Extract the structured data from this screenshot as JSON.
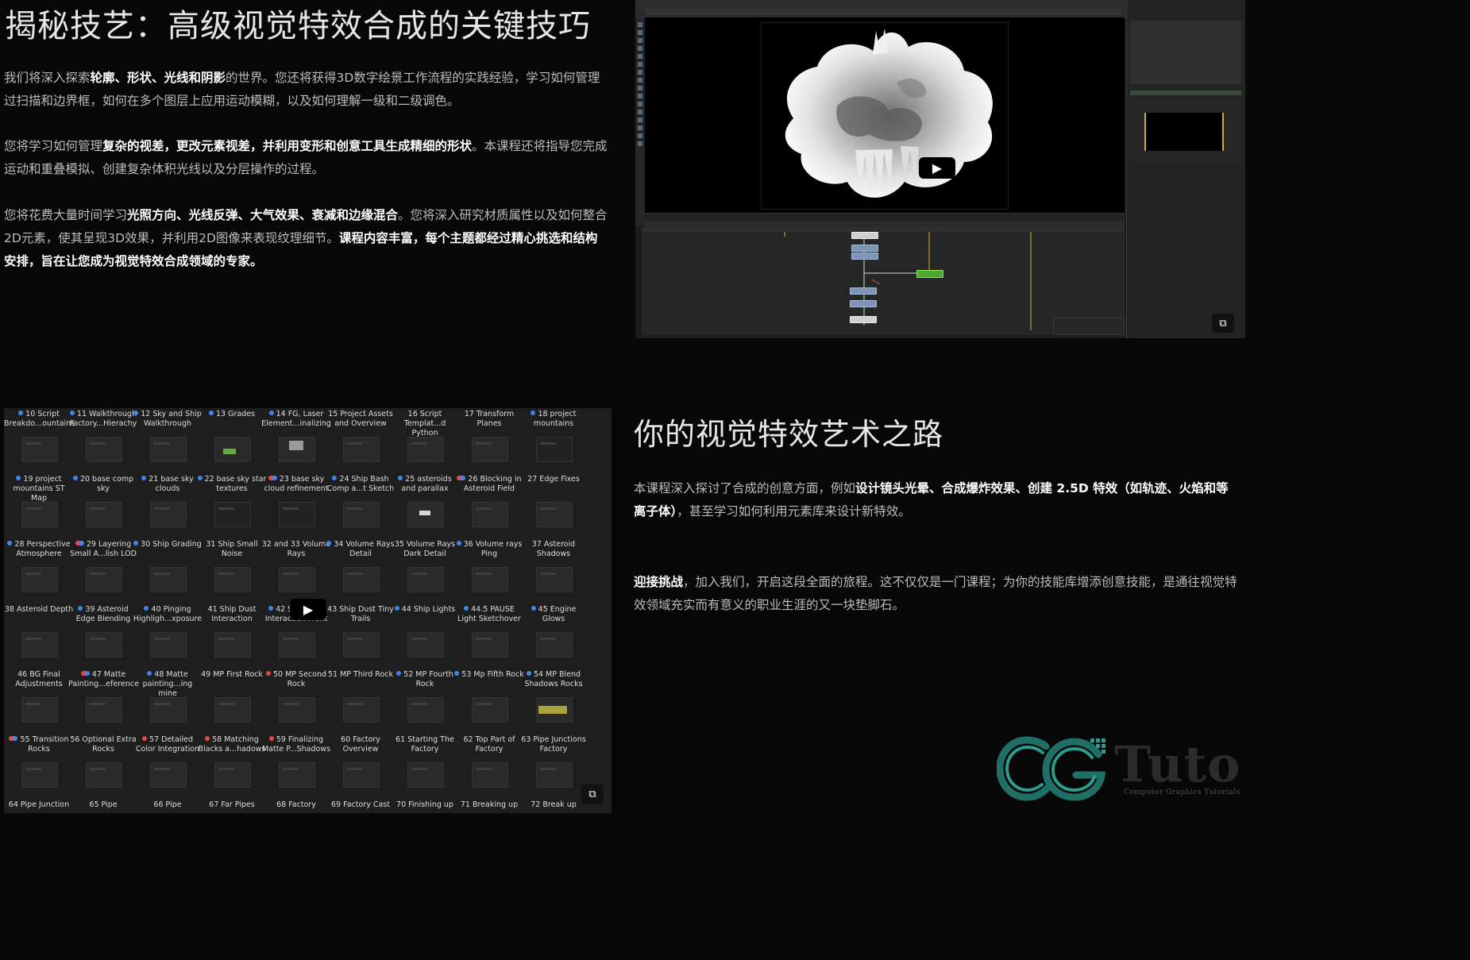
{
  "section1": {
    "title": "揭秘技艺：高级视觉特效合成的关键技巧",
    "p1": [
      {
        "t": "我们将深入探索",
        "b": false
      },
      {
        "t": "轮廓、形状、光线和阴影",
        "b": true
      },
      {
        "t": "的世界。您还将获得3D数字绘景工作流程的实践经验，学习如何管理过扫描和边界框，如何在多个图层上应用运动模糊，以及如何理解一级和二级调色。",
        "b": false
      }
    ],
    "p2": [
      {
        "t": "您将学习如何管理",
        "b": false
      },
      {
        "t": "复杂的视差，更改元素视差，并利用变形和创意工具生成精细的形状",
        "b": true
      },
      {
        "t": "。本课程还将指导您完成运动和重叠模拟、创建复杂体积光线以及分层操作的过程。",
        "b": false
      }
    ],
    "p3": [
      {
        "t": "您将花费大量时间学习",
        "b": false
      },
      {
        "t": "光照方向、光线反弹、大气效果、衰减和边缘混合",
        "b": true
      },
      {
        "t": "。您将深入研究材质属性以及如何整合2D元素，使其呈现3D效果，并利用2D图像来表现纹理细节。",
        "b": false
      },
      {
        "t": "课程内容丰富，每个主题都经过精心挑选和结构安排，旨在让您成为视觉特效合成领域的专家。",
        "b": true
      }
    ]
  },
  "section2": {
    "title": "你的视觉特效艺术之路",
    "p1": [
      {
        "t": "本课程深入探讨了合成的创意方面，例如",
        "b": false
      },
      {
        "t": "设计镜头光晕、合成爆炸效果、创建 2.5D 特效（如轨迹、火焰和等离子体）",
        "b": true
      },
      {
        "t": "，甚至学习如何利用元素库来设计新特效。",
        "b": false
      }
    ],
    "p2": [
      {
        "t": "迎接挑战",
        "b": true
      },
      {
        "t": "，加入我们，开启这段全面的旅程。这不仅仅是一门课程；为你的技能库增添创意技能，是通往视觉特效领域充实而有意义的职业生涯的又一块垫脚石。",
        "b": false
      }
    ]
  },
  "video1": {
    "play_icon": "play-icon",
    "play_glyph": "▶",
    "pip_icon": "picture-in-picture-icon",
    "pip_glyph": "⧉"
  },
  "video2": {
    "play_icon": "play-icon",
    "play_glyph": "▶",
    "pip_icon": "picture-in-picture-icon",
    "pip_glyph": "⧉",
    "rows": [
      [
        {
          "dot": "blue",
          "label": "10 Script Breakdo...ountains",
          "thumb": "plain"
        },
        {
          "dot": "blue",
          "label": "11 Walkthrough Factory...Hierachy",
          "thumb": "plain"
        },
        {
          "dot": "blue",
          "label": "12 Sky and Ship Walkthrough",
          "thumb": "plain"
        },
        {
          "dot": "blue",
          "label": "13 Grades",
          "thumb": "green"
        },
        {
          "dot": "blue",
          "label": "14 FG, Laser Element...inalizing",
          "thumb": "light"
        },
        {
          "dot": "",
          "label": "15 Project Assets and Overview",
          "thumb": "plain"
        },
        {
          "dot": "",
          "label": "16 Script Templat...d Python",
          "thumb": "plain"
        },
        {
          "dot": "",
          "label": "17 Transform Planes",
          "thumb": "plain"
        },
        {
          "dot": "blue",
          "label": "18 project mountains",
          "thumb": "dark"
        }
      ],
      [
        {
          "dot": "blue",
          "label": "19 project mountains ST Map",
          "thumb": "plain"
        },
        {
          "dot": "blue",
          "label": "20 base comp sky",
          "thumb": "plain"
        },
        {
          "dot": "blue",
          "label": "21 base sky clouds",
          "thumb": "plain"
        },
        {
          "dot": "blue",
          "label": "22 base sky star textures",
          "thumb": "dark"
        },
        {
          "dot": "pair",
          "label": "23 base sky cloud refinement",
          "thumb": "dark"
        },
        {
          "dot": "blue",
          "label": "24 Ship Bash Comp a...t Sketch",
          "thumb": "plain"
        },
        {
          "dot": "blue",
          "label": "25 asteroids and parallax",
          "thumb": "bright"
        },
        {
          "dot": "pair",
          "label": "26 Blocking in Asteroid Field",
          "thumb": "plain"
        },
        {
          "dot": "",
          "label": "27 Edge Fixes",
          "thumb": "plain"
        }
      ],
      [
        {
          "dot": "blue",
          "label": "28 Perspective Atmosphere",
          "thumb": "plain"
        },
        {
          "dot": "pair",
          "label": "29 Layering Small A...lish LOD",
          "thumb": "plain"
        },
        {
          "dot": "blue",
          "label": "30 Ship Grading",
          "thumb": "plain"
        },
        {
          "dot": "",
          "label": "31 Ship Small Noise",
          "thumb": "plain"
        },
        {
          "dot": "",
          "label": "32 and 33 Volume Rays",
          "thumb": "plain"
        },
        {
          "dot": "blue",
          "label": "34 Volume Rays Detail",
          "thumb": "plain"
        },
        {
          "dot": "",
          "label": "35 Volume Rays Dark Detail",
          "thumb": "plain"
        },
        {
          "dot": "blue",
          "label": "36 Volume rays Ping",
          "thumb": "plain"
        },
        {
          "dot": "",
          "label": "37 Asteroid Shadows",
          "thumb": "plain"
        }
      ],
      [
        {
          "dot": "",
          "label": "38 Asteroid Depth",
          "thumb": "plain"
        },
        {
          "dot": "blue",
          "label": "39 Asteroid Edge Blending",
          "thumb": "plain"
        },
        {
          "dot": "blue",
          "label": "40 Pinging Highligh...xposure",
          "thumb": "plain"
        },
        {
          "dot": "",
          "label": "41 Ship Dust Interaction",
          "thumb": "plain"
        },
        {
          "dot": "blue",
          "label": "42 Ship Dust Interaction Front",
          "thumb": "plain"
        },
        {
          "dot": "",
          "label": "43 Ship Dust Tiny Trails",
          "thumb": "plain"
        },
        {
          "dot": "blue",
          "label": "44 Ship Lights",
          "thumb": "plain"
        },
        {
          "dot": "blue",
          "label": "44.5 PAUSE Light Sketchover",
          "thumb": "plain"
        },
        {
          "dot": "blue",
          "label": "45 Engine Glows",
          "thumb": "plain"
        }
      ],
      [
        {
          "dot": "",
          "label": "46 BG Final Adjustments",
          "thumb": "plain"
        },
        {
          "dot": "pair",
          "label": "47 Matte Painting...eference",
          "thumb": "plain"
        },
        {
          "dot": "blue",
          "label": "48 Matte painting...ing mine",
          "thumb": "plain"
        },
        {
          "dot": "",
          "label": "49 MP First Rock",
          "thumb": "plain"
        },
        {
          "dot": "red",
          "label": "50 MP Second Rock",
          "thumb": "plain"
        },
        {
          "dot": "",
          "label": "51 MP Third Rock",
          "thumb": "plain"
        },
        {
          "dot": "blue",
          "label": "52 MP Fourth Rock",
          "thumb": "plain"
        },
        {
          "dot": "blue",
          "label": "53 Mp Fifth Rock",
          "thumb": "plain"
        },
        {
          "dot": "blue",
          "label": "54 MP Blend Shadows Rocks",
          "thumb": "yellow"
        }
      ],
      [
        {
          "dot": "pair",
          "label": "55 Transition Rocks",
          "thumb": "plain"
        },
        {
          "dot": "",
          "label": "56 Optional Extra Rocks",
          "thumb": "plain"
        },
        {
          "dot": "red",
          "label": "57 Detailed Color Integration",
          "thumb": "plain"
        },
        {
          "dot": "red",
          "label": "58 Matching Blacks a...hadows",
          "thumb": "plain"
        },
        {
          "dot": "red",
          "label": "59 Finalizing Matte P...Shadows",
          "thumb": "plain"
        },
        {
          "dot": "",
          "label": "60 Factory Overview",
          "thumb": "plain"
        },
        {
          "dot": "",
          "label": "61 Starting The Factory",
          "thumb": "plain"
        },
        {
          "dot": "",
          "label": "62 Top Part of Factory",
          "thumb": "plain"
        },
        {
          "dot": "",
          "label": "63 Pipe Junctions Factory",
          "thumb": "plain"
        }
      ],
      [
        {
          "dot": "",
          "label": "64 Pipe Junction",
          "thumb": "none"
        },
        {
          "dot": "",
          "label": "65 Pipe",
          "thumb": "none"
        },
        {
          "dot": "",
          "label": "66 Pipe",
          "thumb": "none"
        },
        {
          "dot": "",
          "label": "67 Far Pipes",
          "thumb": "none"
        },
        {
          "dot": "",
          "label": "68 Factory",
          "thumb": "none"
        },
        {
          "dot": "",
          "label": "69 Factory Cast",
          "thumb": "none"
        },
        {
          "dot": "",
          "label": "70 Finishing up",
          "thumb": "none"
        },
        {
          "dot": "",
          "label": "71 Breaking up",
          "thumb": "none"
        },
        {
          "dot": "",
          "label": "72 Break up",
          "thumb": "none"
        }
      ]
    ]
  },
  "logo": {
    "text": "Tuto",
    "subtitle": "Computer Graphics Tutorials",
    "accent": "#2a9d8f",
    "accent2": "#1f6f66"
  }
}
